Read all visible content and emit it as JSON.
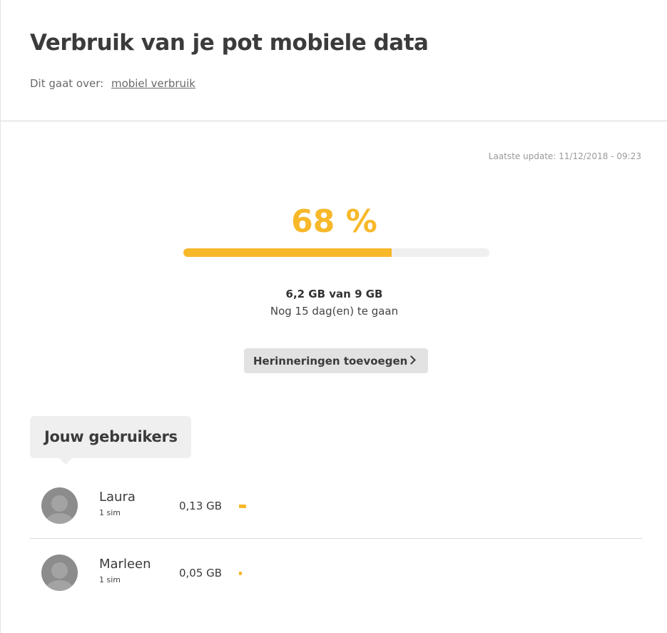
{
  "header": {
    "title": "Verbruik van je pot mobiele data",
    "topic_prefix": "Dit gaat over:",
    "topic_link": "mobiel verbruik"
  },
  "summary": {
    "last_update": "Laatste update: 11/12/2018 - 09:23",
    "percent_label": "68 %",
    "percent_value": 0.68,
    "usage": "6,2 GB van 9 GB",
    "remaining": "Nog 15 dag(en) te gaan",
    "reminder_button": "Herinneringen toevoegen"
  },
  "colors": {
    "accent": "#f7b82a",
    "track": "#efefef"
  },
  "users": {
    "heading": "Jouw gebruikers",
    "items": [
      {
        "name": "Laura",
        "sims": "1 sim",
        "usage": "0,13 GB",
        "usage_gb": 0.13
      },
      {
        "name": "Marleen",
        "sims": "1 sim",
        "usage": "0,05 GB",
        "usage_gb": 0.05
      }
    ]
  }
}
